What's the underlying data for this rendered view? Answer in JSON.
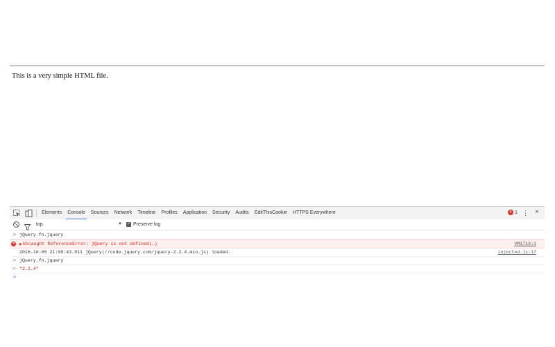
{
  "page": {
    "text": "This is a very simple HTML file."
  },
  "devtools": {
    "tabs": [
      {
        "label": "Elements"
      },
      {
        "label": "Console"
      },
      {
        "label": "Sources"
      },
      {
        "label": "Network"
      },
      {
        "label": "Timeline"
      },
      {
        "label": "Profiles"
      },
      {
        "label": "Application"
      },
      {
        "label": "Security"
      },
      {
        "label": "Audits"
      },
      {
        "label": "EditThisCookie"
      },
      {
        "label": "HTTPS Everywhere"
      }
    ],
    "active_tab": "Console",
    "error_count": "1",
    "toolbar": {
      "context": "top",
      "preserve_log": "Preserve log",
      "preserve_checked": true
    },
    "console": {
      "rows": [
        {
          "type": "input",
          "prefix": ">",
          "text": "jQuery.fn.jquery"
        },
        {
          "type": "error",
          "text": "Uncaught ReferenceError: jQuery is not defined(…)",
          "source": "VM1719:1"
        },
        {
          "type": "log",
          "text": "2016-10-05 21:00:43.911 jQuery(//code.jquery.com/jquery-2.2.4.min.js) loaded.",
          "source": "injected.js:17"
        },
        {
          "type": "input",
          "prefix": ">",
          "text": "jQuery.fn.jquery"
        },
        {
          "type": "result",
          "prefix": "<·",
          "text": "\"2.2.4\""
        },
        {
          "type": "prompt",
          "prefix": ">",
          "text": ""
        }
      ]
    }
  },
  "colors": {
    "accent": "#3879d9",
    "error": "#d93025",
    "error_bg": "#fff0f0",
    "string": "#c41a16"
  }
}
